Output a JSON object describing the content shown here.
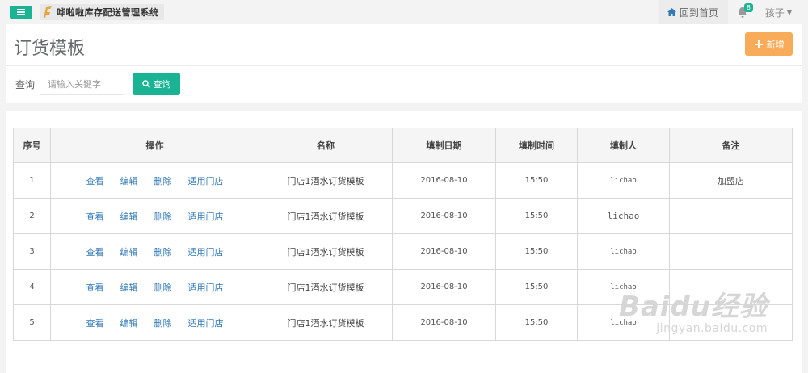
{
  "app": {
    "title": "哗啦啦库存配送管理系统"
  },
  "nav": {
    "home": "回到首页",
    "badge_count": "8",
    "user": "孩子"
  },
  "page": {
    "title": "订货模板",
    "add_label": "新增"
  },
  "search": {
    "label": "查询",
    "placeholder": "请输入关键字",
    "button": "查询"
  },
  "table": {
    "headers": [
      "序号",
      "操作",
      "名称",
      "填制日期",
      "填制时间",
      "填制人",
      "备注"
    ],
    "actions": [
      "查看",
      "编辑",
      "删除",
      "适用门店"
    ],
    "rows": [
      {
        "no": "1",
        "name": "门店1酒水订货模板",
        "date": "2016-08-10",
        "time": "15:50",
        "creator": "lichao",
        "note": "加盟店"
      },
      {
        "no": "2",
        "name": "门店1酒水订货模板",
        "date": "2016-08-10",
        "time": "15:50",
        "creator": "lichao",
        "note": ""
      },
      {
        "no": "3",
        "name": "门店1酒水订货模板",
        "date": "2016-08-10",
        "time": "15:50",
        "creator": "lichao",
        "note": ""
      },
      {
        "no": "4",
        "name": "门店1酒水订货模板",
        "date": "2016-08-10",
        "time": "15:50",
        "creator": "lichao",
        "note": ""
      },
      {
        "no": "5",
        "name": "门店1酒水订货模板",
        "date": "2016-08-10",
        "time": "15:50",
        "creator": "lichao",
        "note": ""
      }
    ]
  },
  "watermark": {
    "logo": "Baidu经验",
    "url": "jingyan.baidu.com"
  },
  "colors": {
    "primary": "#1ab394",
    "warning": "#f8ac59",
    "link": "#337ab7"
  },
  "icons": {
    "menu": "menu-icon",
    "home": "home-icon",
    "bell": "bell-icon",
    "search": "search-icon",
    "plus": "plus-icon"
  }
}
